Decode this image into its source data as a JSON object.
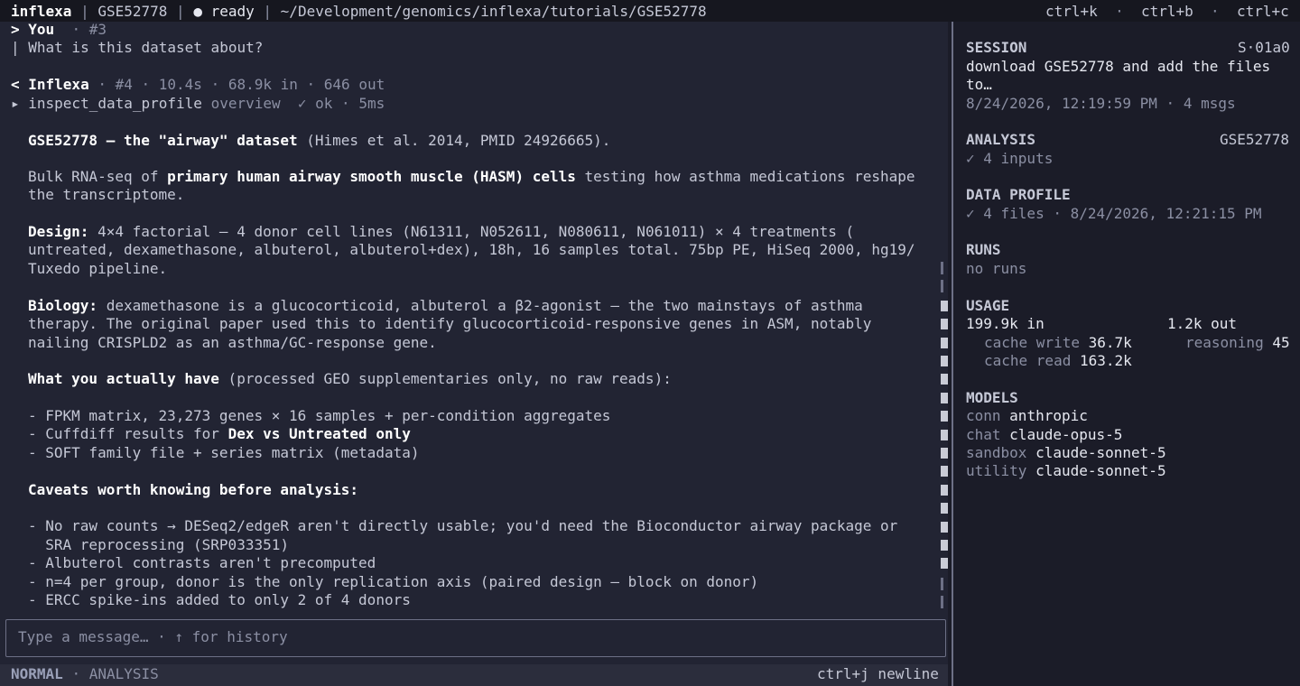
{
  "topbar": {
    "app_name": "inflexa",
    "dataset": "GSE52778",
    "status_dot": "●",
    "status": "ready",
    "path": "~/Development/genomics/inflexa/tutorials/GSE52778",
    "shortcut_1": "ctrl+k",
    "shortcut_2": "ctrl+b",
    "shortcut_3": "ctrl+c"
  },
  "chat": {
    "user_prefix": "> You",
    "user_msg_id": "· #3",
    "user_text": "| What is this dataset about?",
    "assistant_prefix": "< Inflexa",
    "assistant_meta": " · #4 · 10.4s · 68.9k in · 646 out",
    "tool_name": "▸ inspect_data_profile",
    "tool_arg": "overview",
    "tool_status": "✓ ok · 5ms",
    "p1_bold": "GSE52778 — the \"airway\" dataset",
    "p1_rest": " (Himes et al. 2014, PMID 24926665).",
    "p2_a": "Bulk RNA-seq of ",
    "p2_bold": "primary human airway smooth muscle (HASM) cells",
    "p2_b": " testing how asthma medications reshape",
    "p2_line2": "the transcriptome.",
    "p3_bold": "Design:",
    "p3_a": " 4×4 factorial — 4 donor cell lines (N61311, N052611, N080611, N061011) × 4 treatments (",
    "p3_line2": "untreated, dexamethasone, albuterol, albuterol+dex), 18h, 16 samples total. 75bp PE, HiSeq 2000, hg19/",
    "p3_line3": "Tuxedo pipeline.",
    "p4_bold": "Biology:",
    "p4_a": " dexamethasone is a glucocorticoid, albuterol a β2-agonist — the two mainstays of asthma",
    "p4_line2": "therapy. The original paper used this to identify glucocorticoid-responsive genes in ASM, notably",
    "p4_line3": "nailing CRISPLD2 as an asthma/GC-response gene.",
    "p5_bold": "What you actually have",
    "p5_rest": " (processed GEO supplementaries only, no raw reads):",
    "li1": "- FPKM matrix, 23,273 genes × 16 samples + per-condition aggregates",
    "li2_a": "- Cuffdiff results for ",
    "li2_bold": "Dex vs Untreated only",
    "li3": "- SOFT family file + series matrix (metadata)",
    "p6_bold": "Caveats worth knowing before analysis:",
    "c1": "- No raw counts → DESeq2/edgeR aren't directly usable; you'd need the Bioconductor airway package or",
    "c1_line2": "  SRA reprocessing (SRP033351)",
    "c2": "- Albuterol contrasts aren't precomputed",
    "c3": "- n=4 per group, donor is the only replication axis (paired design — block on donor)",
    "c4": "- ERCC spike-ins added to only 2 of 4 donors"
  },
  "input": {
    "placeholder": "Type a message… · ↑ for history"
  },
  "statusbar": {
    "mode": "NORMAL",
    "context": "· ANALYSIS",
    "hint": "ctrl+j newline"
  },
  "sidebar": {
    "session_label": "SESSION",
    "session_id": "S·01a0",
    "session_title_1": "download GSE52778 and add the files",
    "session_title_2": "to…",
    "session_meta": "8/24/2026, 12:19:59 PM · 4 msgs",
    "analysis_label": "ANALYSIS",
    "analysis_id": "GSE52778",
    "analysis_inputs": "✓ 4 inputs",
    "profile_label": "DATA PROFILE",
    "profile_meta": "✓ 4 files · 8/24/2026, 12:21:15 PM",
    "runs_label": "RUNS",
    "runs_value": "no runs",
    "usage_label": "USAGE",
    "usage_in": "199.9k in",
    "usage_out": "1.2k out",
    "cache_write_label": "cache write",
    "cache_write": "36.7k",
    "reasoning_label": "reasoning",
    "reasoning": "45",
    "cache_read_label": "cache read",
    "cache_read": "163.2k",
    "models_label": "MODELS",
    "conn_label": "conn",
    "conn": "anthropic",
    "chat_label": "chat",
    "chat": "claude-opus-5",
    "sandbox_label": "sandbox",
    "sandbox": "claude-sonnet-5",
    "utility_label": "utility",
    "utility": "claude-sonnet-5"
  },
  "colors": {
    "background": "#1c1d2b",
    "main_pane": "#222433",
    "accent_white": "#ffffff",
    "dim_text": "#8b8fa3"
  }
}
